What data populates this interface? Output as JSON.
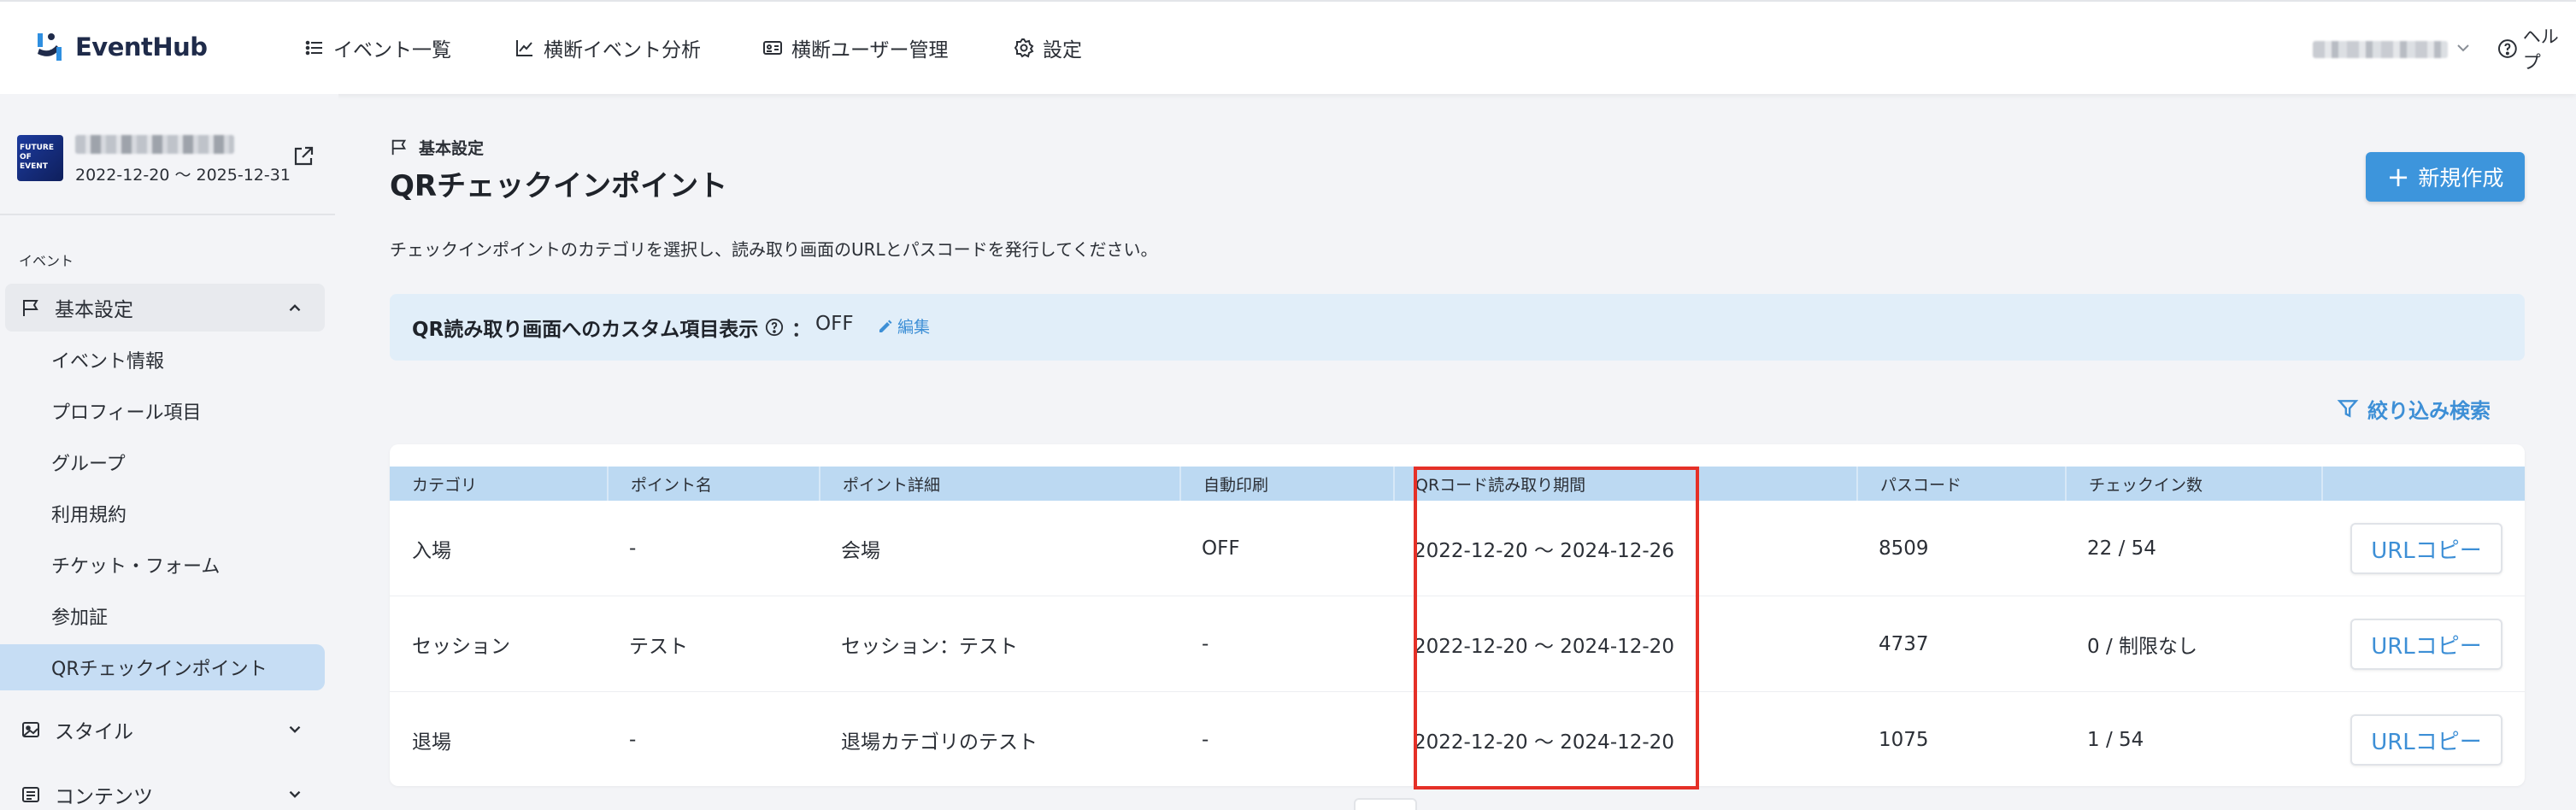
{
  "app": {
    "name": "EventHub"
  },
  "nav": {
    "items": [
      {
        "label": "イベント一覧",
        "icon": "list-icon"
      },
      {
        "label": "横断イベント分析",
        "icon": "chart-line-icon"
      },
      {
        "label": "横断ユーザー管理",
        "icon": "id-card-icon"
      },
      {
        "label": "設定",
        "icon": "gear-icon"
      }
    ],
    "help_label": "ヘルプ"
  },
  "sidebar": {
    "event": {
      "dates": "2022-12-20 〜 2025-12-31",
      "thumb_text": "FUTURE OF EVENT"
    },
    "caption": "イベント",
    "groups": [
      {
        "label": "基本設定",
        "icon": "flag-icon",
        "expanded": true
      },
      {
        "label": "スタイル",
        "icon": "image-icon",
        "expanded": false
      },
      {
        "label": "コンテンツ",
        "icon": "list-icon",
        "expanded": false
      }
    ],
    "sub_items": [
      {
        "label": "イベント情報"
      },
      {
        "label": "プロフィール項目"
      },
      {
        "label": "グループ"
      },
      {
        "label": "利用規約"
      },
      {
        "label": "チケット・フォーム"
      },
      {
        "label": "参加証"
      },
      {
        "label": "QRチェックインポイント",
        "active": true
      }
    ]
  },
  "main": {
    "breadcrumb": "基本設定",
    "title": "QRチェックインポイント",
    "new_button_label": "新規作成",
    "description": "チェックインポイントのカテゴリを選択し、読み取り画面のURLとパスコードを発行してください。",
    "custom_display": {
      "label": "QR読み取り画面へのカスタム項目表示",
      "colon": "：",
      "value": "OFF",
      "edit_label": "編集"
    },
    "filter_label": "絞り込み検索",
    "table": {
      "columns": [
        "カテゴリ",
        "ポイント名",
        "ポイント詳細",
        "自動印刷",
        "QRコード読み取り期間",
        "パスコード",
        "チェックイン数"
      ],
      "rows": [
        {
          "category": "入場",
          "point_name": "-",
          "point_detail": "会場",
          "auto_print": "OFF",
          "period": "2022-12-20 〜 2024-12-26",
          "passcode": "8509",
          "checkins": "22 / 54",
          "copy_label": "URLコピー"
        },
        {
          "category": "セッション",
          "point_name": "テスト",
          "point_detail": "セッション：テスト",
          "auto_print": "-",
          "period": "2022-12-20 〜 2024-12-20",
          "passcode": "4737",
          "checkins": "0 / 制限なし",
          "copy_label": "URLコピー"
        },
        {
          "category": "退場",
          "point_name": "-",
          "point_detail": "退場カテゴリのテスト",
          "auto_print": "-",
          "period": "2022-12-20 〜 2024-12-20",
          "passcode": "1075",
          "checkins": "1 / 54",
          "copy_label": "URLコピー"
        }
      ]
    }
  },
  "colors": {
    "accent": "#3d95dc",
    "link": "#3d8fd6",
    "highlight": "#e53027",
    "table_header": "#bcd9f2",
    "active_item": "#c6ddf4"
  }
}
